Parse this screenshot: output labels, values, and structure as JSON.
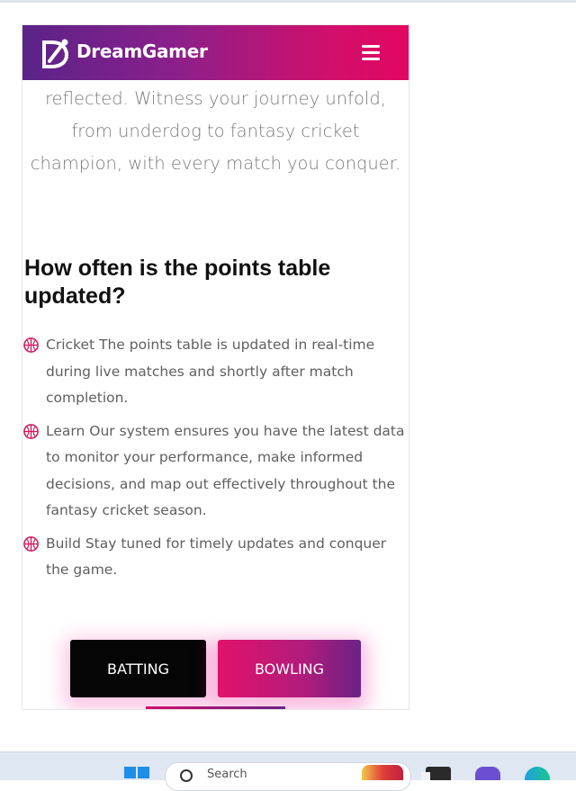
{
  "header": {
    "brand": "DreamGamer",
    "logo_icon": "dreamgamer-logo-icon",
    "menu_icon": "hamburger-menu-icon",
    "gradient_start": "#5b2389",
    "gradient_end": "#e3075f"
  },
  "intro": {
    "lines": [
      "reflected. Witness your journey unfold,",
      "from underdog to fantasy cricket",
      "champion, with every match you conquer."
    ]
  },
  "faq": {
    "title": "How often is the points table updated?",
    "items": [
      {
        "icon": "cricket-ball-icon",
        "lines": [
          "Cricket The points table is updated in real-time",
          "during live matches and shortly after match",
          "completion."
        ]
      },
      {
        "icon": "cricket-ball-icon",
        "lines": [
          "Learn Our system ensures you have the latest data",
          "to monitor your performance, make informed",
          "decisions, and map out effectively throughout the",
          "fantasy cricket season."
        ]
      },
      {
        "icon": "cricket-ball-icon",
        "lines": [
          "Build Stay tuned for timely updates and conquer",
          "the game."
        ]
      }
    ]
  },
  "tabs": {
    "batting_label": "BATTING",
    "bowling_label": "BOWLING",
    "accent": "#e3116a"
  },
  "taskbar": {
    "search_placeholder": "Search"
  }
}
